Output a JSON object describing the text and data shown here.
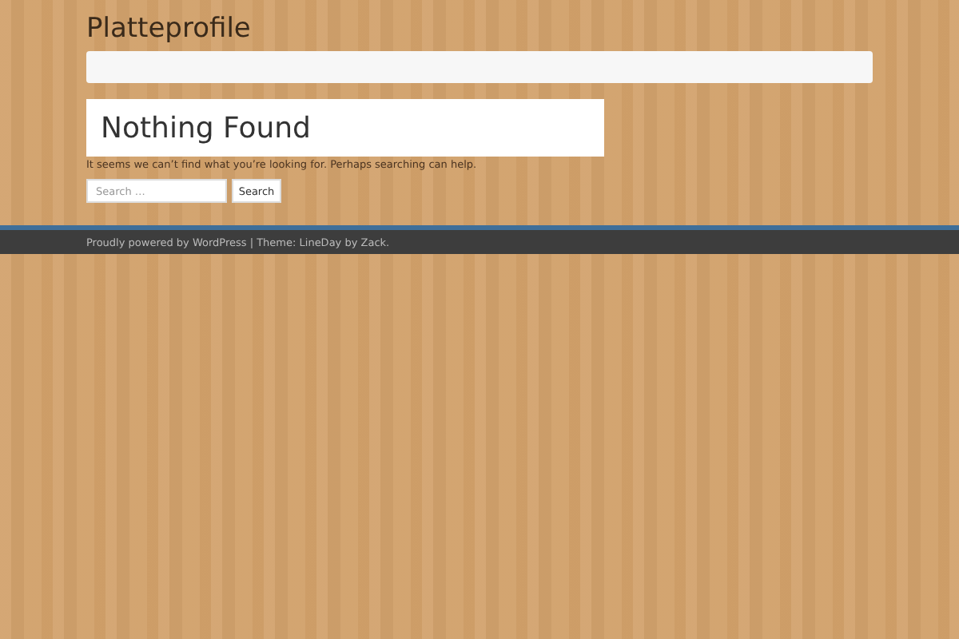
{
  "site_title": "Platteprofile",
  "page_title": "Nothing Found",
  "message": "It seems we can’t find what you’re looking for. Perhaps searching can help.",
  "search": {
    "placeholder": "Search …",
    "button": "Search"
  },
  "footer": "Proudly powered by WordPress | Theme: LineDay by Zack."
}
